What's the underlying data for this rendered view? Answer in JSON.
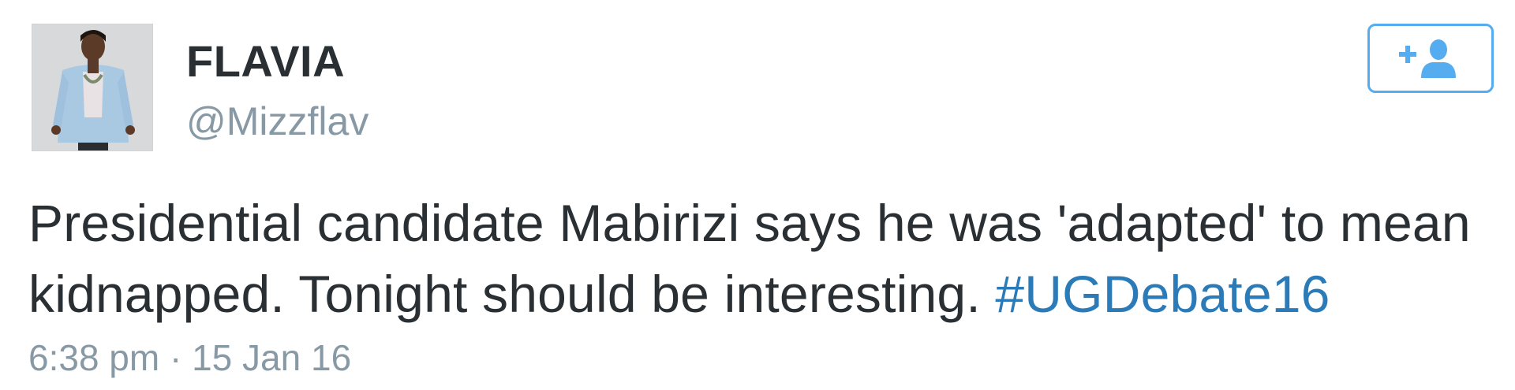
{
  "user": {
    "display_name": "FLAVIA",
    "handle": "@Mizzflav"
  },
  "follow_button": {
    "icon": "follow-user-icon"
  },
  "tweet": {
    "text_part1": "Presidential candidate Mabirizi says he was 'adapted' to mean kidnapped. Tonight should be interesting. ",
    "hashtag": "#UGDebate16",
    "timestamp": "6:38 pm · 15 Jan 16"
  },
  "colors": {
    "accent": "#55acee",
    "hashtag": "#2b7bb9",
    "text": "#292f33",
    "muted": "#8899a6"
  }
}
